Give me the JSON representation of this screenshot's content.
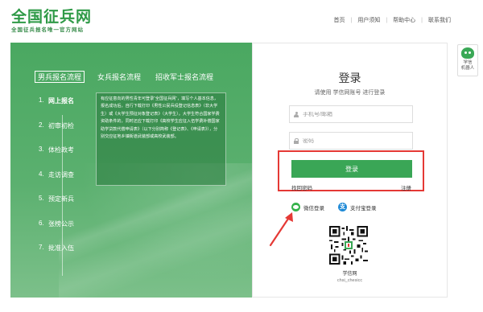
{
  "header": {
    "logo_title": "全国征兵网",
    "logo_subtitle": "全国征兵报名唯一官方网站",
    "nav": [
      "首页",
      "用户须知",
      "帮助中心",
      "联系我们"
    ]
  },
  "widget": {
    "label_line1": "学信",
    "label_line2": "机器人"
  },
  "left_panel": {
    "tabs": [
      "男兵报名流程",
      "女兵报名流程",
      "招收军士报名流程"
    ],
    "steps": [
      {
        "num": "1.",
        "label": "网上报名"
      },
      {
        "num": "2.",
        "label": "初审初检"
      },
      {
        "num": "3.",
        "label": "体检政考"
      },
      {
        "num": "4.",
        "label": "走访调查"
      },
      {
        "num": "5.",
        "label": "预定新兵"
      },
      {
        "num": "6.",
        "label": "张榜公示"
      },
      {
        "num": "7.",
        "label": "批准入伍"
      }
    ],
    "info_text": "有应征意向的男性青年可登录“全国征兵网”，填写个人基本信息，报名成功后，自行下载打印《男性公民兵役登记信息表》（非大学生）或《大学生预征对象登记表》（大学生）。大学生符合国家学费资助条件的，同时还应下载打印《高校学生应征入伍学费补偿国家助学贷款代偿申请表》（以下分别简称《登记表》、《申请表》），分别交应征地乡镇街道武装部或高校武装部。"
  },
  "login": {
    "title": "登录",
    "subtitle": "请使用 学信网账号 进行登录",
    "username_placeholder": "手机号/邮箱",
    "password_placeholder": "密码",
    "login_button": "登录",
    "forgot_link": "找回密码",
    "register_link": "注册",
    "wechat_label": "微信登录",
    "alipay_label": "支付宝登录",
    "alipay_glyph": "支",
    "qr_caption": "学信网",
    "qr_subcaption": "chsi_chesicc"
  },
  "colors": {
    "brand_green": "#2f9a47",
    "button_green": "#3aa656",
    "highlight_red": "#e53935"
  }
}
